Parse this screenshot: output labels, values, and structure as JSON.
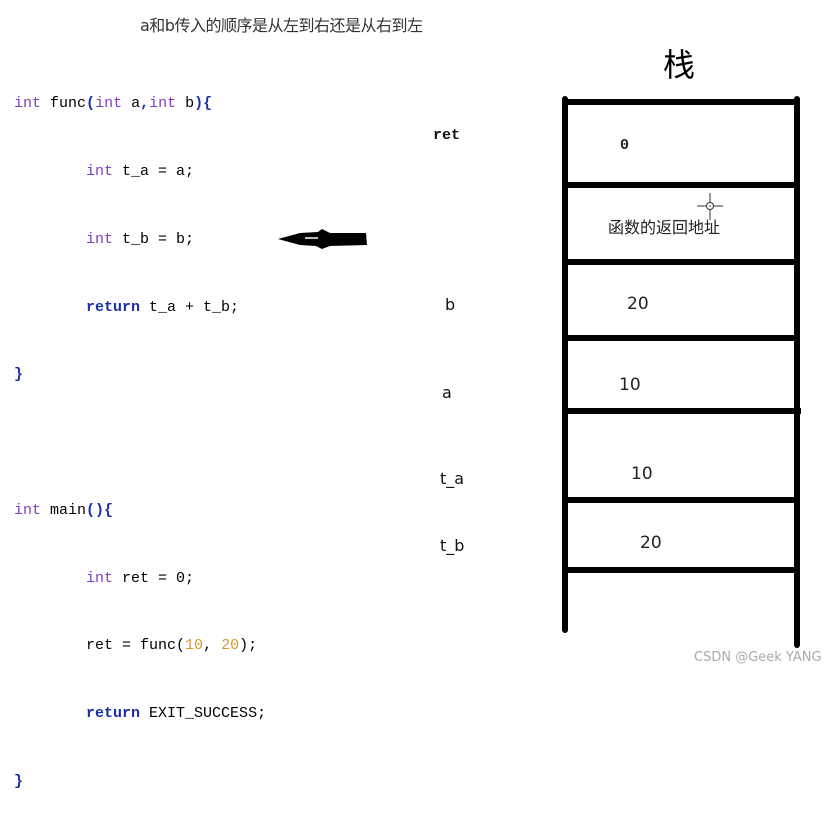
{
  "title": "a和b传入的顺序是从左到右还是从右到左",
  "code": {
    "func_signature": {
      "ret_type": "int",
      "name": "func",
      "p1_type": "int",
      "p1": "a",
      "p2_type": "int",
      "p2": "b"
    },
    "func_body": [
      {
        "type": "int",
        "text": "t_a = a;"
      },
      {
        "type": "int",
        "text": "t_b = b;"
      },
      {
        "keyword": "return",
        "text": "t_a + t_b;"
      }
    ],
    "main_signature": {
      "ret_type": "int",
      "name": "main"
    },
    "main_body": {
      "decl_type": "int",
      "decl_text": "ret = 0;",
      "call_prefix": "ret = func(",
      "arg1": "10",
      "arg2": "20",
      "call_suffix": ");",
      "return_kw": "return",
      "return_val": "EXIT_SUCCESS;"
    }
  },
  "stack": {
    "title": "栈",
    "frames": [
      {
        "label": "ret",
        "value": "0"
      },
      {
        "label": "",
        "value": "函数的返回地址"
      },
      {
        "label": "b",
        "value": "20"
      },
      {
        "label": "a",
        "value": "10"
      },
      {
        "label": "t_a",
        "value": "10"
      },
      {
        "label": "t_b",
        "value": "20"
      }
    ]
  },
  "arrow": {
    "points_to": "ret = func(10, 20);",
    "direction": "left"
  },
  "watermark": "CSDN @Geek YANG"
}
